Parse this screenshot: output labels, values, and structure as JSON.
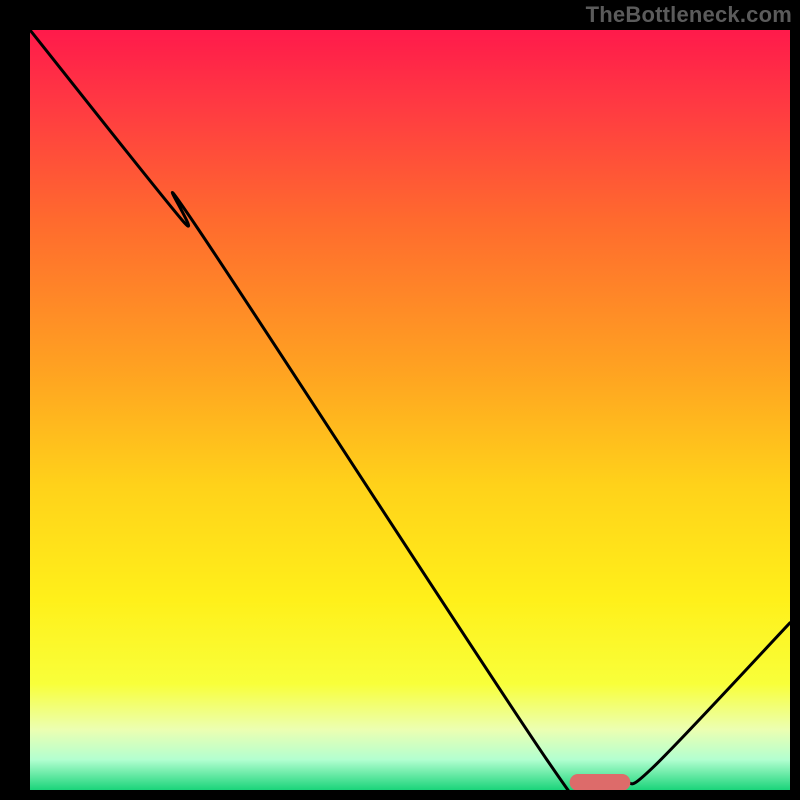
{
  "watermark": "TheBottleneck.com",
  "chart_data": {
    "type": "line",
    "title": "",
    "xlabel": "",
    "ylabel": "",
    "xlim": [
      0,
      100
    ],
    "ylim": [
      0,
      100
    ],
    "grid": false,
    "legend": false,
    "series": [
      {
        "name": "curve",
        "x": [
          0,
          20,
          22,
          68,
          72,
          78,
          82,
          100
        ],
        "y": [
          100,
          75,
          74,
          4,
          1,
          1,
          3,
          22
        ]
      }
    ],
    "marker": {
      "x_center": 75,
      "y": 1,
      "width": 8,
      "height": 2.2,
      "color": "#dd6b6a"
    },
    "gradient_stops": [
      {
        "offset": 0.0,
        "color": "#ff1a4b"
      },
      {
        "offset": 0.1,
        "color": "#ff3a42"
      },
      {
        "offset": 0.25,
        "color": "#ff6a2e"
      },
      {
        "offset": 0.45,
        "color": "#ffa321"
      },
      {
        "offset": 0.6,
        "color": "#ffd21a"
      },
      {
        "offset": 0.75,
        "color": "#fff01a"
      },
      {
        "offset": 0.86,
        "color": "#f8ff3a"
      },
      {
        "offset": 0.92,
        "color": "#ecffb1"
      },
      {
        "offset": 0.96,
        "color": "#b3ffd0"
      },
      {
        "offset": 1.0,
        "color": "#1bd47a"
      }
    ]
  }
}
